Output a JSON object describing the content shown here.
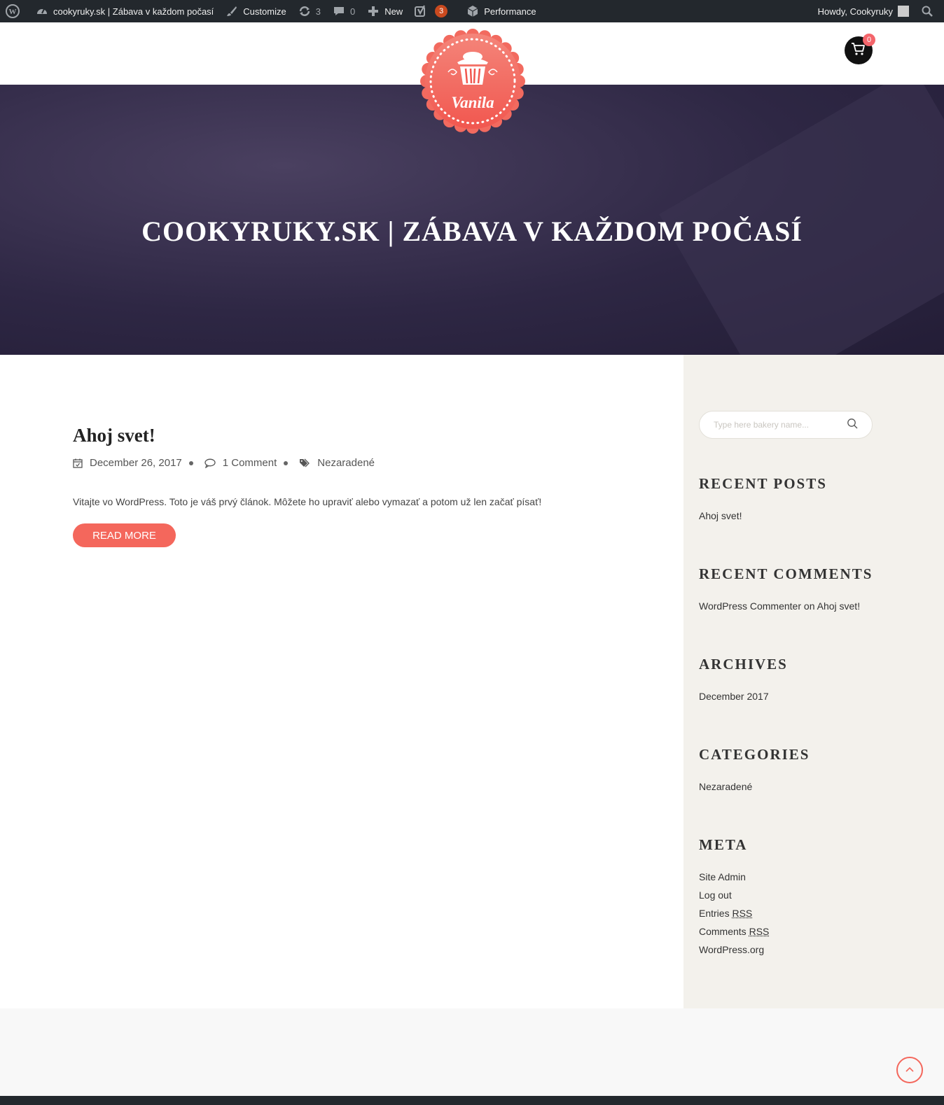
{
  "admin_bar": {
    "site_name": "cookyruky.sk | Zábava v každom počasí",
    "customize": "Customize",
    "updates_count": "3",
    "comments_count": "0",
    "new_label": "New",
    "yoast_badge": "3",
    "performance": "Performance",
    "howdy": "Howdy, Cookyruky"
  },
  "header": {
    "logo_text": "Vanila",
    "cart_count": "0"
  },
  "hero": {
    "title": "COOKYRUKY.SK | ZÁBAVA V KAŽDOM POČASÍ"
  },
  "post": {
    "title": "Ahoj svet!",
    "date": "December 26, 2017",
    "comments": "1 Comment",
    "category": "Nezaradené",
    "excerpt": "Vitajte vo WordPress. Toto je váš prvý článok. Môžete ho upraviť alebo vymazať a potom už len začať písať!",
    "read_more": "READ MORE"
  },
  "sidebar": {
    "search_placeholder": "Type here bakery name...",
    "recent_posts": {
      "title": "RECENT POSTS",
      "items": [
        "Ahoj svet!"
      ]
    },
    "recent_comments": {
      "title": "RECENT COMMENTS",
      "author": "WordPress Commenter",
      "on": "on",
      "post": "Ahoj svet!"
    },
    "archives": {
      "title": "ARCHIVES",
      "items": [
        "December 2017"
      ]
    },
    "categories": {
      "title": "CATEGORIES",
      "items": [
        "Nezaradené"
      ]
    },
    "meta": {
      "title": "META",
      "site_admin": "Site Admin",
      "log_out": "Log out",
      "entries": "Entries",
      "comments": "Comments",
      "rss": "RSS",
      "wordpress_org": "WordPress.org"
    }
  },
  "colors": {
    "accent": "#f4675c",
    "admin_bar": "#23282d",
    "hero_bg": "#2e2744",
    "sidebar_bg": "#f3f1ec"
  }
}
